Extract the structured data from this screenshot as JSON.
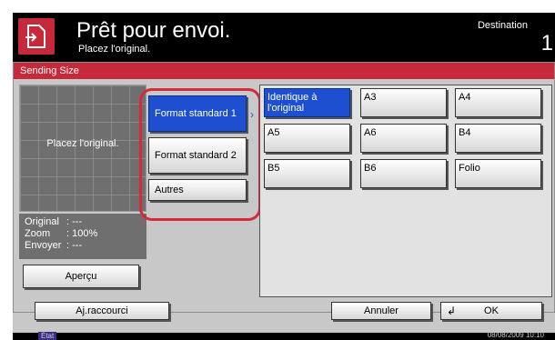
{
  "header": {
    "title": "Prêt pour envoi.",
    "subtitle": "Placez l'original.",
    "destination_label": "Destination",
    "destination_count": "1"
  },
  "panel": {
    "title": "Sending Size",
    "preview_text": "Placez l'original.",
    "info": [
      {
        "key": "Original",
        "value": ": ---"
      },
      {
        "key": "Zoom",
        "value": ": 100%"
      },
      {
        "key": "Envoyer",
        "value": ": ---"
      }
    ],
    "preview_button": "Aperçu",
    "formats": [
      {
        "label": "Format standard 1",
        "selected": true
      },
      {
        "label": "Format standard 2",
        "selected": false
      },
      {
        "label": "Autres",
        "selected": false
      }
    ],
    "sizes": [
      {
        "label": "Identique à l'original",
        "selected": true
      },
      {
        "label": "A3",
        "selected": false
      },
      {
        "label": "A4",
        "selected": false
      },
      {
        "label": "A5",
        "selected": false
      },
      {
        "label": "A6",
        "selected": false
      },
      {
        "label": "B4",
        "selected": false
      },
      {
        "label": "B5",
        "selected": false
      },
      {
        "label": "B6",
        "selected": false
      },
      {
        "label": "Folio",
        "selected": false
      }
    ]
  },
  "bottom": {
    "shortcut_label": "Aj.raccourci",
    "cancel_label": "Annuler",
    "ok_label": "OK"
  },
  "status": {
    "state_label": "État",
    "datetime": "08/08/2009    10:10"
  },
  "colors": {
    "accent_red": "#c7283a",
    "selected_blue": "#1d4fd0",
    "highlight_ring": "#d52a3a"
  }
}
